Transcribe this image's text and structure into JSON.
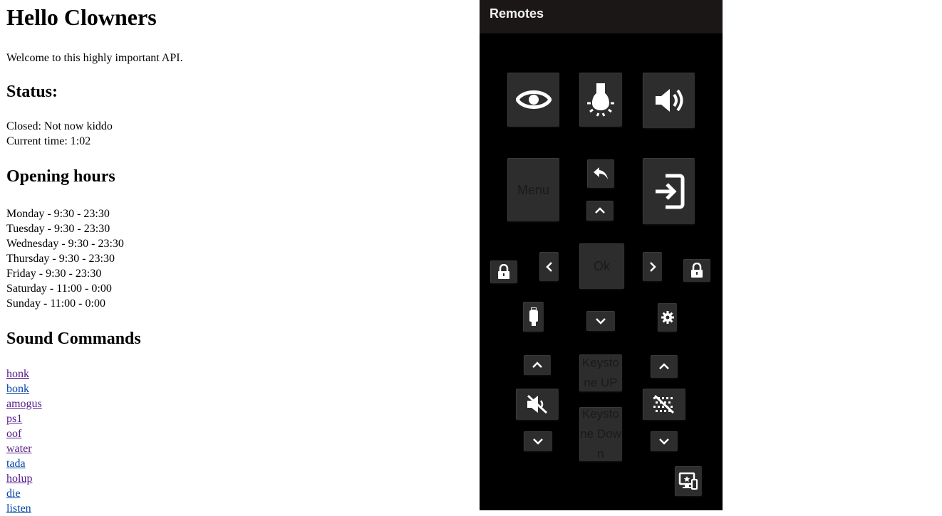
{
  "page": {
    "title": "Hello Clowners",
    "welcome": "Welcome to this highly important API.",
    "status": {
      "heading": "Status:",
      "state": "Closed: Not now kiddo",
      "time": "Current time: 1:02"
    },
    "hours": {
      "heading": "Opening hours",
      "days": [
        "Monday - 9:30 - 23:30",
        "Tuesday - 9:30 - 23:30",
        "Wednesday - 9:30 - 23:30",
        "Thursday - 9:30 - 23:30",
        "Friday - 9:30 - 23:30",
        "Saturday - 11:00 - 0:00",
        "Sunday - 11:00 - 0:00"
      ]
    },
    "sounds": {
      "heading": "Sound Commands",
      "links": [
        "honk",
        "bonk",
        "amogus",
        "ps1",
        "oof",
        "water",
        "tada",
        "holup",
        "die",
        "listen"
      ]
    }
  },
  "remote": {
    "title": "Remotes",
    "menu_label": "Menu",
    "ok_label": "Ok",
    "keystone_up_label": "Keystone UP",
    "keystone_down_label": "Keystone Down",
    "icons": {
      "eye": "eye-icon",
      "light": "bulb-icon",
      "volume": "volume-icon",
      "back": "back-arrow-icon",
      "input": "input-icon",
      "lock": "lock-icon",
      "hdmi": "hdmi-icon",
      "settings": "gear-icon",
      "mute": "mute-icon",
      "blank": "blank-screen-icon",
      "display": "display-settings-icon"
    },
    "colors": {
      "panel": "#000000",
      "header": "#1b1716",
      "button": "#2d2d2d",
      "icon": "#ffffff"
    }
  }
}
